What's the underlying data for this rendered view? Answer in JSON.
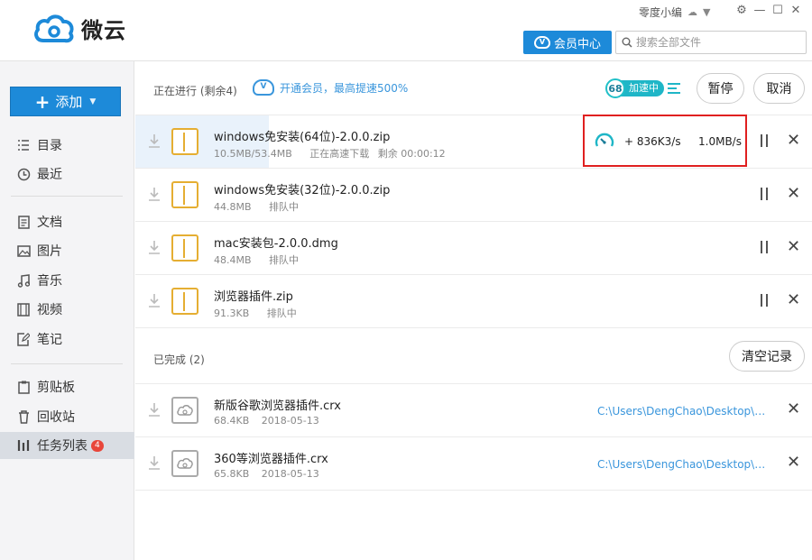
{
  "app": {
    "name": "微云"
  },
  "header": {
    "user_name": "零度小编",
    "vip_button": "会员中心",
    "search_placeholder": "搜索全部文件"
  },
  "sidebar": {
    "add_label": "添加",
    "items": [
      {
        "label": "目录",
        "icon": "folder-tree-icon"
      },
      {
        "label": "最近",
        "icon": "clock-icon"
      },
      {
        "label": "文档",
        "icon": "document-icon"
      },
      {
        "label": "图片",
        "icon": "image-icon"
      },
      {
        "label": "音乐",
        "icon": "music-icon"
      },
      {
        "label": "视频",
        "icon": "video-icon"
      },
      {
        "label": "笔记",
        "icon": "note-icon"
      },
      {
        "label": "剪贴板",
        "icon": "clipboard-icon"
      },
      {
        "label": "回收站",
        "icon": "trash-icon"
      },
      {
        "label": "任务列表",
        "icon": "task-list-icon",
        "badge": "4",
        "active": true
      }
    ]
  },
  "in_progress": {
    "title": "正在进行 (剩余4)",
    "vip_promo": "开通会员，最高提速500%",
    "accel_level": "68",
    "accel_label": "加速中",
    "pause_all": "暂停",
    "cancel_all": "取消",
    "tasks": [
      {
        "name": "windows免安装(64位)-2.0.0.zip",
        "size": "10.5MB/53.4MB",
        "status": "正在高速下载",
        "remaining": "剩余 00:00:12",
        "speed_boost": "+ 836K3/s",
        "speed": "1.0MB/s",
        "progress": 0.197
      },
      {
        "name": "windows免安装(32位)-2.0.0.zip",
        "size": "44.8MB",
        "status": "排队中"
      },
      {
        "name": "mac安装包-2.0.0.dmg",
        "size": "48.4MB",
        "status": "排队中"
      },
      {
        "name": "浏览器插件.zip",
        "size": "91.3KB",
        "status": "排队中"
      }
    ]
  },
  "completed": {
    "title": "已完成 (2)",
    "clear_button": "清空记录",
    "tasks": [
      {
        "name": "新版谷歌浏览器插件.crx",
        "size": "68.4KB",
        "date": "2018-05-13",
        "path": "C:\\Users\\DengChao\\Desktop\\高速..."
      },
      {
        "name": "360等浏览器插件.crx",
        "size": "65.8KB",
        "date": "2018-05-13",
        "path": "C:\\Users\\DengChao\\Desktop\\高速..."
      }
    ]
  },
  "colors": {
    "accent": "#1d8ad9",
    "highlight_box": "#e02020",
    "zip_icon": "#e5ae32"
  }
}
